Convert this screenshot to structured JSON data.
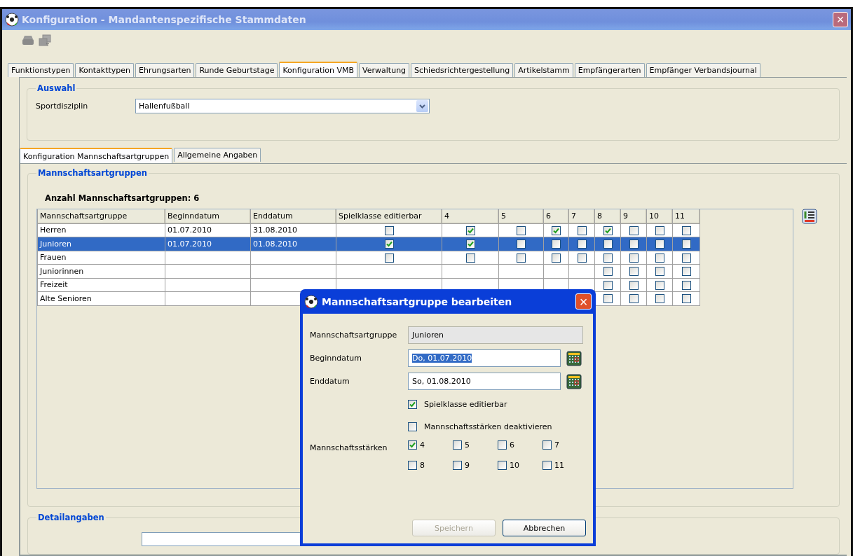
{
  "window": {
    "title": "Konfiguration - Mandantenspezifische Stammdaten",
    "close": "×"
  },
  "tabs": [
    {
      "label": "Funktionstypen",
      "selected": false
    },
    {
      "label": "Kontakttypen",
      "selected": false
    },
    {
      "label": "Ehrungsarten",
      "selected": false
    },
    {
      "label": "Runde Geburtstage",
      "selected": false
    },
    {
      "label": "Konfiguration VMB",
      "selected": true
    },
    {
      "label": "Verwaltung",
      "selected": false
    },
    {
      "label": "Schiedsrichtergestellung",
      "selected": false
    },
    {
      "label": "Artikelstamm",
      "selected": false
    },
    {
      "label": "Empfängerarten",
      "selected": false
    },
    {
      "label": "Empfänger Verbandsjournal",
      "selected": false
    }
  ],
  "auswahl": {
    "title": "Auswahl",
    "label": "Sportdisziplin",
    "value": "Hallenfußball"
  },
  "subtabs": [
    {
      "label": "Konfiguration Mannschaftsartgruppen",
      "selected": true
    },
    {
      "label": "Allgemeine Angaben",
      "selected": false
    }
  ],
  "group": {
    "title": "Mannschaftsartgruppen",
    "count_label": "Anzahl Mannschaftsartgruppen: 6"
  },
  "table": {
    "columns": [
      "Mannschaftsartgruppe",
      "Beginndatum",
      "Enddatum",
      "Spielklasse editierbar",
      "4",
      "5",
      "6",
      "7",
      "8",
      "9",
      "10",
      "11"
    ],
    "rows": [
      {
        "name": "Herren",
        "begin": "01.07.2010",
        "end": "31.08.2010",
        "selected": false,
        "checks": [
          false,
          true,
          false,
          true,
          false,
          true,
          false,
          false,
          false
        ]
      },
      {
        "name": "Junioren",
        "begin": "01.07.2010",
        "end": "01.08.2010",
        "selected": true,
        "checks": [
          true,
          true,
          false,
          false,
          false,
          false,
          false,
          false,
          false
        ]
      },
      {
        "name": "Frauen",
        "selected": false,
        "checks": [
          false,
          false,
          false,
          false,
          false,
          false,
          false,
          false,
          false
        ]
      },
      {
        "name": "Juniorinnen",
        "selected": false,
        "checks": [
          false,
          false,
          false,
          false
        ]
      },
      {
        "name": "Freizeit",
        "selected": false,
        "checks": [
          false,
          false,
          false,
          false
        ]
      },
      {
        "name": "Alte Senioren",
        "selected": false,
        "checks": [
          false,
          false,
          false,
          false
        ]
      }
    ]
  },
  "detail": {
    "title": "Detailangaben"
  },
  "dialog": {
    "title": "Mannschaftsartgruppe bearbeiten",
    "close": "×",
    "fields": [
      {
        "label": "Mannschaftsartgruppe",
        "value": "Junioren",
        "kind": "readonly"
      },
      {
        "label": "Beginndatum",
        "value": "Do, 01.07.2010",
        "kind": "date",
        "highlighted": true
      },
      {
        "label": "Enddatum",
        "value": "So, 01.08.2010",
        "kind": "date",
        "highlighted": false
      }
    ],
    "options": [
      {
        "label": "Spielklasse editierbar",
        "checked": true
      },
      {
        "label": "Mannschaftsstärken deaktivieren",
        "checked": false
      }
    ],
    "strengths_label": "Mannschaftsstärken",
    "strengths": [
      {
        "label": "4",
        "checked": true
      },
      {
        "label": "5",
        "checked": false
      },
      {
        "label": "6",
        "checked": false
      },
      {
        "label": "7",
        "checked": false
      },
      {
        "label": "8",
        "checked": false
      },
      {
        "label": "9",
        "checked": false
      },
      {
        "label": "10",
        "checked": false
      },
      {
        "label": "11",
        "checked": false
      }
    ],
    "buttons": [
      {
        "label": "Speichern",
        "disabled": true
      },
      {
        "label": "Abbrechen",
        "disabled": false
      }
    ]
  }
}
